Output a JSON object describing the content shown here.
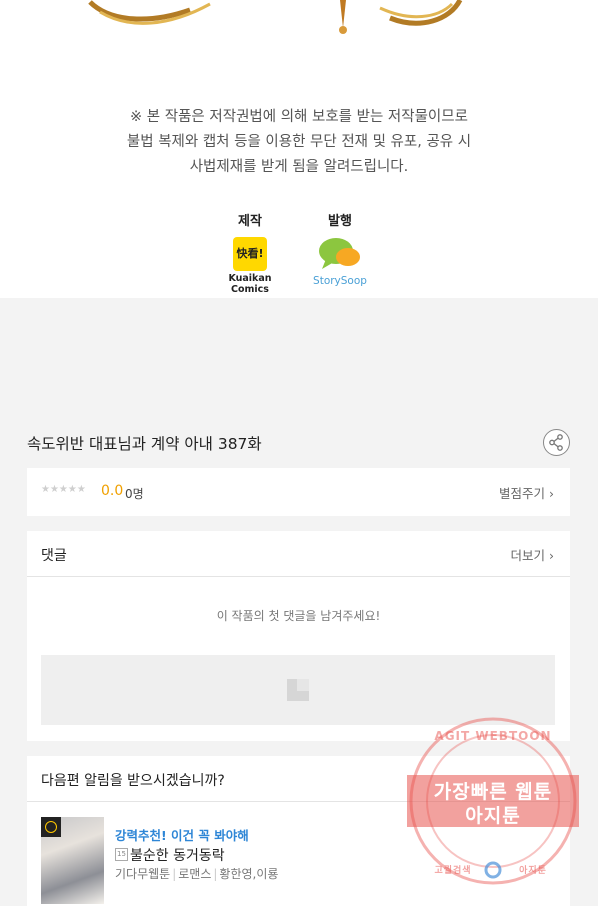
{
  "notice": {
    "lines": [
      "※ 본 작품은 저작권법에 의해 보호를 받는 저작물이므로",
      "불법 복제와 캡처 등을 이용한 무단 전재 및 유포, 공유 시",
      "사법제재를 받게 됨을 알려드립니다."
    ]
  },
  "credits": {
    "production_label": "제작",
    "production_logo_text": "快看!",
    "production_name": "Kuaikan Comics",
    "publisher_label": "발행",
    "publisher_name": "StorySoop"
  },
  "episode": {
    "title": "속도위반 대표님과 계약 아내 387화"
  },
  "rating": {
    "stars": "★★★★★",
    "score": "0.0",
    "count": "0명",
    "rate_link": "별점주기 ›"
  },
  "comments": {
    "heading": "댓글",
    "more_link": "더보기 ›",
    "empty_message": "이 작품의 첫 댓글을 남겨주세요!"
  },
  "next_episode": {
    "heading": "다음편 알림을 받으시겠습니까?",
    "recommend_label": "강력추천! 이건 꼭 봐야해",
    "age_badge": "15",
    "title": "불순한 동거동락",
    "tags": [
      "기다무웹툰",
      "로맨스",
      "황한영,이룡"
    ]
  },
  "watermark": {
    "arc_text": "AGIT WEBTOON",
    "line1": "가장빠른 웹툰",
    "line2": "아지툰",
    "bottom_left": "고퀄검색",
    "bottom_right": "아지툰",
    "color": "#e8544f"
  },
  "colors": {
    "accent_blue": "#2e86d6",
    "score_orange": "#f0a000",
    "logo_yellow": "#ffd800"
  }
}
